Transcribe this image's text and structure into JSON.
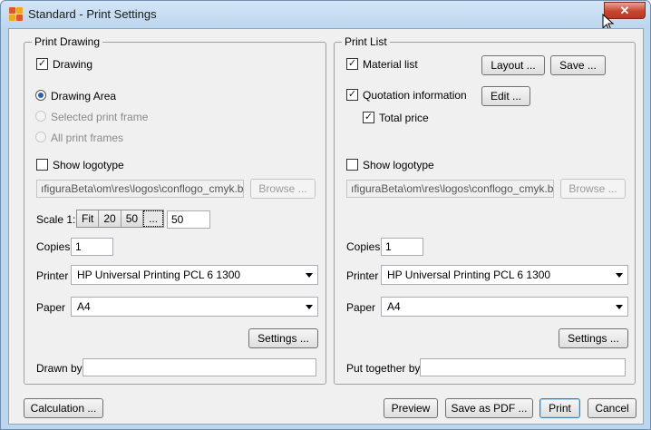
{
  "window": {
    "title": "Standard - Print Settings",
    "close_glyph": "✕",
    "accent_close": "#c7452d"
  },
  "drawing": {
    "legend": "Print Drawing",
    "drawing_label": "Drawing",
    "drawing_checked": true,
    "area_options": [
      {
        "label": "Drawing Area",
        "selected": true,
        "enabled": true
      },
      {
        "label": "Selected print frame",
        "selected": false,
        "enabled": false
      },
      {
        "label": "All print frames",
        "selected": false,
        "enabled": false
      }
    ],
    "show_logotype_label": "Show logotype",
    "show_logotype_checked": false,
    "logo_path": "ıfiguraBeta\\om\\res\\logos\\conflogo_cmyk.bmp",
    "browse_label": "Browse ...",
    "scale_label": "Scale 1:",
    "scale_options": [
      "Fit",
      "20",
      "50",
      "..."
    ],
    "scale_value": "50",
    "copies_label": "Copies",
    "copies_value": "1",
    "printer_label": "Printer",
    "printer_value": "HP Universal Printing PCL 6 1300",
    "paper_label": "Paper",
    "paper_value": "A4",
    "settings_label": "Settings ...",
    "drawn_by_label": "Drawn by",
    "drawn_by_value": ""
  },
  "list": {
    "legend": "Print List",
    "material_label": "Material list",
    "material_checked": true,
    "layout_label": "Layout ...",
    "save_label": "Save ...",
    "quotation_label": "Quotation information",
    "quotation_checked": true,
    "edit_label": "Edit ...",
    "total_price_label": "Total price",
    "total_price_checked": true,
    "show_logotype_label": "Show logotype",
    "show_logotype_checked": false,
    "logo_path": "ıfiguraBeta\\om\\res\\logos\\conflogo_cmyk.bmp",
    "browse_label": "Browse ...",
    "copies_label": "Copies",
    "copies_value": "1",
    "printer_label": "Printer",
    "printer_value": "HP Universal Printing PCL 6 1300",
    "paper_label": "Paper",
    "paper_value": "A4",
    "settings_label": "Settings ...",
    "put_together_label": "Put together by",
    "put_together_value": ""
  },
  "footer": {
    "calculation_label": "Calculation ...",
    "preview_label": "Preview",
    "save_pdf_label": "Save as PDF ...",
    "print_label": "Print",
    "cancel_label": "Cancel"
  }
}
